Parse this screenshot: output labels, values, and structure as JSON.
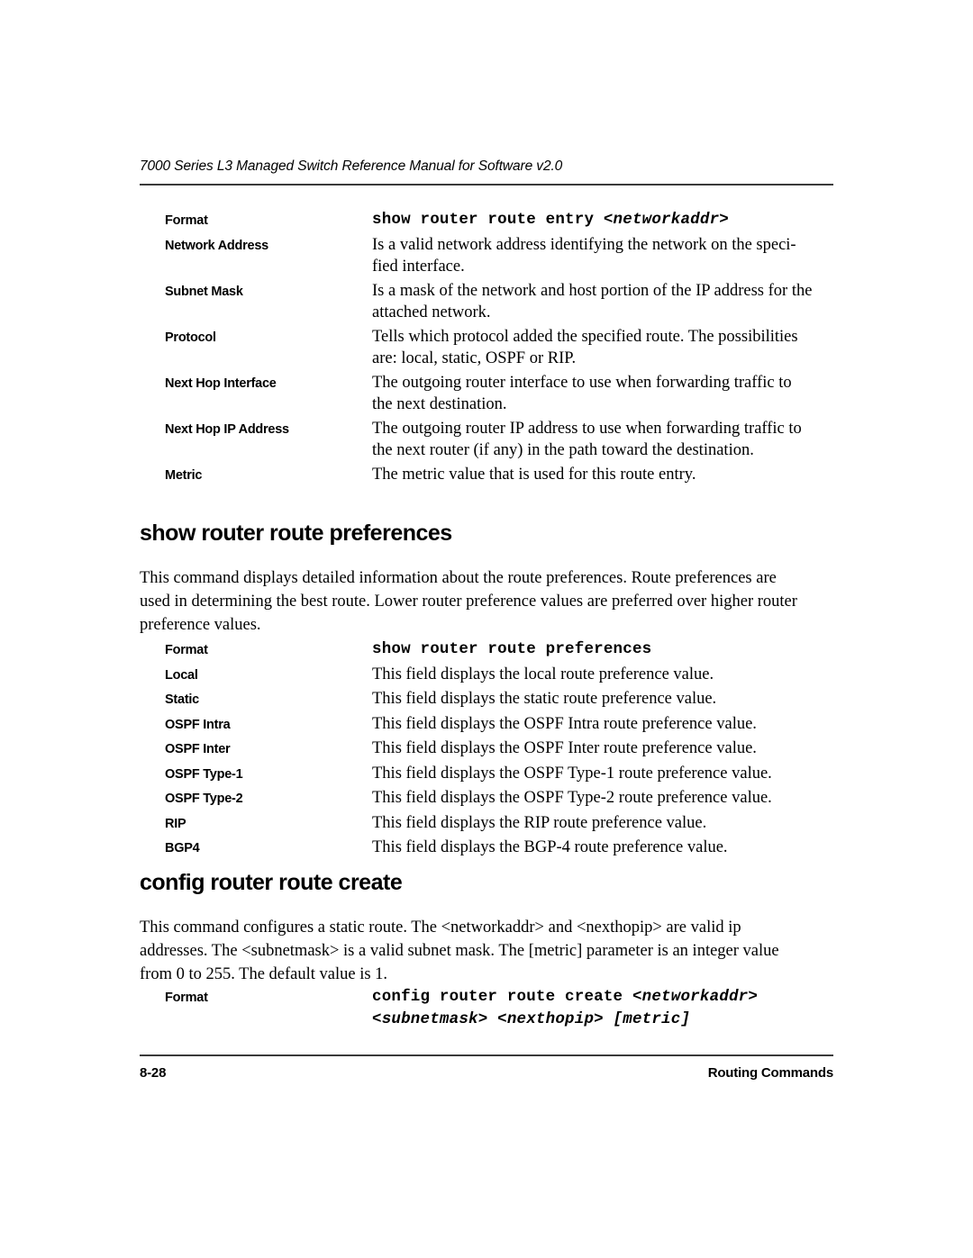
{
  "page": {
    "running_header": "7000 Series L3 Managed Switch Reference Manual for Software v2.0",
    "footer_page_number": "8-28",
    "footer_section": "Routing Commands"
  },
  "sections": [
    {
      "id": "show-router-route-entry",
      "heading": null,
      "rows": [
        {
          "term": "Format",
          "type": "mono",
          "mono_parts": [
            {
              "text": "show router route entry ",
              "italic": false
            },
            {
              "text": "<networkaddr>",
              "italic": true
            }
          ]
        },
        {
          "term": "Network Address",
          "type": "text",
          "lines": [
            "Is a valid network address identifying the network on the speci-",
            "fied interface."
          ]
        },
        {
          "term": "Subnet Mask",
          "type": "text",
          "lines": [
            "Is a mask of the network and host portion of the IP address for the",
            "attached network."
          ]
        },
        {
          "term": "Protocol",
          "type": "text",
          "lines": [
            "Tells which protocol added the specified route. The possibilities",
            "are: local, static, OSPF or RIP."
          ]
        },
        {
          "term": "Next Hop Interface",
          "type": "text",
          "lines": [
            "The outgoing router interface to use when forwarding traffic to",
            "the next destination."
          ]
        },
        {
          "term": "Next Hop IP Address",
          "type": "text",
          "lines": [
            "The outgoing router IP address to use when forwarding traffic to",
            "the next router (if any) in the path toward the destination."
          ]
        },
        {
          "term": "Metric",
          "type": "text",
          "lines": [
            "The metric value that is used for this route entry."
          ]
        }
      ]
    },
    {
      "id": "show-router-route-preferences",
      "heading": "show router route preferences",
      "intro_lines": [
        "This command displays detailed information about the route preferences. Route preferences are",
        "used in determining the best route. Lower router preference values are preferred over higher router",
        "preference values."
      ],
      "rows": [
        {
          "term": "Format",
          "type": "mono",
          "mono_parts": [
            {
              "text": "show router route preferences",
              "italic": false
            }
          ]
        },
        {
          "term": "Local",
          "type": "text",
          "lines": [
            "This field displays the local route preference value."
          ]
        },
        {
          "term": "Static",
          "type": "text",
          "lines": [
            "This field displays the static route preference value."
          ]
        },
        {
          "term": "OSPF Intra",
          "type": "text",
          "lines": [
            "This field displays the OSPF Intra route preference value."
          ]
        },
        {
          "term": "OSPF Inter",
          "type": "text",
          "lines": [
            "This field displays the OSPF Inter route preference value."
          ]
        },
        {
          "term": "OSPF Type-1",
          "type": "text",
          "lines": [
            "This field displays the OSPF Type-1 route preference value."
          ]
        },
        {
          "term": "OSPF Type-2",
          "type": "text",
          "lines": [
            "This field displays the OSPF Type-2 route preference value."
          ]
        },
        {
          "term": "RIP",
          "type": "text",
          "lines": [
            "This field displays the RIP route preference value."
          ]
        },
        {
          "term": "BGP4",
          "type": "text",
          "lines": [
            "This field displays the BGP-4 route preference value."
          ]
        }
      ]
    },
    {
      "id": "config-router-route-create",
      "heading": "config router route create",
      "intro_lines": [
        "This command configures a static route.   The <networkaddr> and <nexthopip> are valid ip",
        "addresses. The <subnetmask> is a valid subnet mask. The [metric] parameter is an integer value",
        "from 0 to 255. The default value is 1."
      ],
      "rows": [
        {
          "term": "Format",
          "type": "mono-multiline",
          "mono_lines": [
            [
              {
                "text": "config router route create ",
                "italic": false
              },
              {
                "text": "<networkaddr>",
                "italic": true
              }
            ],
            [
              {
                "text": "<subnetmask> <nexthopip> [metric]",
                "italic": true
              }
            ]
          ]
        }
      ]
    }
  ]
}
